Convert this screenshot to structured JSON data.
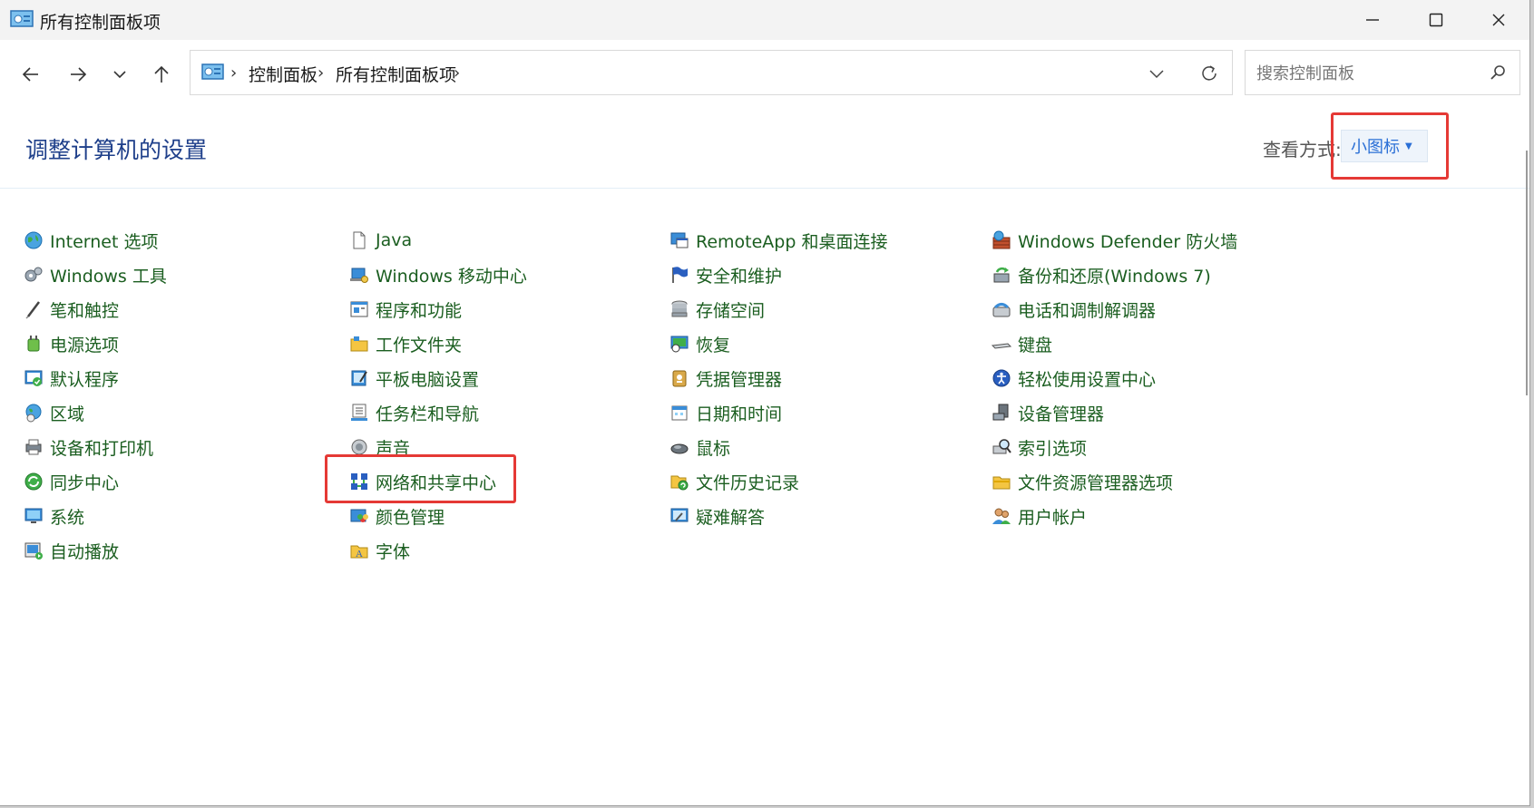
{
  "window": {
    "title": "所有控制面板项",
    "icon": "control-panel-icon"
  },
  "address": {
    "crumbs": [
      "控制面板",
      "所有控制面板项"
    ]
  },
  "search": {
    "placeholder": "搜索控制面板"
  },
  "header": {
    "title": "调整计算机的设置",
    "view_by_label": "查看方式:",
    "view_by_value": "小图标"
  },
  "items": [
    {
      "label": "Internet 选项",
      "icon": "globe-icon"
    },
    {
      "label": "Windows 工具",
      "icon": "gears-icon"
    },
    {
      "label": "笔和触控",
      "icon": "pen-icon"
    },
    {
      "label": "电源选项",
      "icon": "power-plug-icon"
    },
    {
      "label": "默认程序",
      "icon": "default-programs-icon"
    },
    {
      "label": "区域",
      "icon": "globe-clock-icon"
    },
    {
      "label": "设备和打印机",
      "icon": "printer-icon"
    },
    {
      "label": "同步中心",
      "icon": "sync-icon"
    },
    {
      "label": "系统",
      "icon": "monitor-icon"
    },
    {
      "label": "自动播放",
      "icon": "autoplay-icon"
    },
    {
      "label": "Java",
      "icon": "file-icon"
    },
    {
      "label": "Windows 移动中心",
      "icon": "mobility-icon"
    },
    {
      "label": "程序和功能",
      "icon": "programs-icon"
    },
    {
      "label": "工作文件夹",
      "icon": "folder-icon"
    },
    {
      "label": "平板电脑设置",
      "icon": "tablet-icon"
    },
    {
      "label": "任务栏和导航",
      "icon": "taskbar-icon"
    },
    {
      "label": "声音",
      "icon": "speaker-icon"
    },
    {
      "label": "网络和共享中心",
      "icon": "network-icon"
    },
    {
      "label": "颜色管理",
      "icon": "color-icon"
    },
    {
      "label": "字体",
      "icon": "font-folder-icon"
    },
    {
      "label": "RemoteApp 和桌面连接",
      "icon": "remoteapp-icon"
    },
    {
      "label": "安全和维护",
      "icon": "flag-icon"
    },
    {
      "label": "存储空间",
      "icon": "storage-icon"
    },
    {
      "label": "恢复",
      "icon": "recovery-icon"
    },
    {
      "label": "凭据管理器",
      "icon": "credential-icon"
    },
    {
      "label": "日期和时间",
      "icon": "calendar-icon"
    },
    {
      "label": "鼠标",
      "icon": "mouse-icon"
    },
    {
      "label": "文件历史记录",
      "icon": "file-history-icon"
    },
    {
      "label": "疑难解答",
      "icon": "troubleshoot-icon"
    },
    {
      "label": "Windows Defender 防火墙",
      "icon": "firewall-icon"
    },
    {
      "label": "备份和还原(Windows 7)",
      "icon": "backup-icon"
    },
    {
      "label": "电话和调制解调器",
      "icon": "phone-icon"
    },
    {
      "label": "键盘",
      "icon": "keyboard-icon"
    },
    {
      "label": "轻松使用设置中心",
      "icon": "accessibility-icon"
    },
    {
      "label": "设备管理器",
      "icon": "device-manager-icon"
    },
    {
      "label": "索引选项",
      "icon": "indexing-icon"
    },
    {
      "label": "文件资源管理器选项",
      "icon": "folder-options-icon"
    },
    {
      "label": "用户帐户",
      "icon": "users-icon"
    }
  ],
  "colors": {
    "heading": "#1e3f8a",
    "item_text": "#1b5e20",
    "highlight": "#e53935",
    "dropdown_text": "#2a6fd6"
  }
}
